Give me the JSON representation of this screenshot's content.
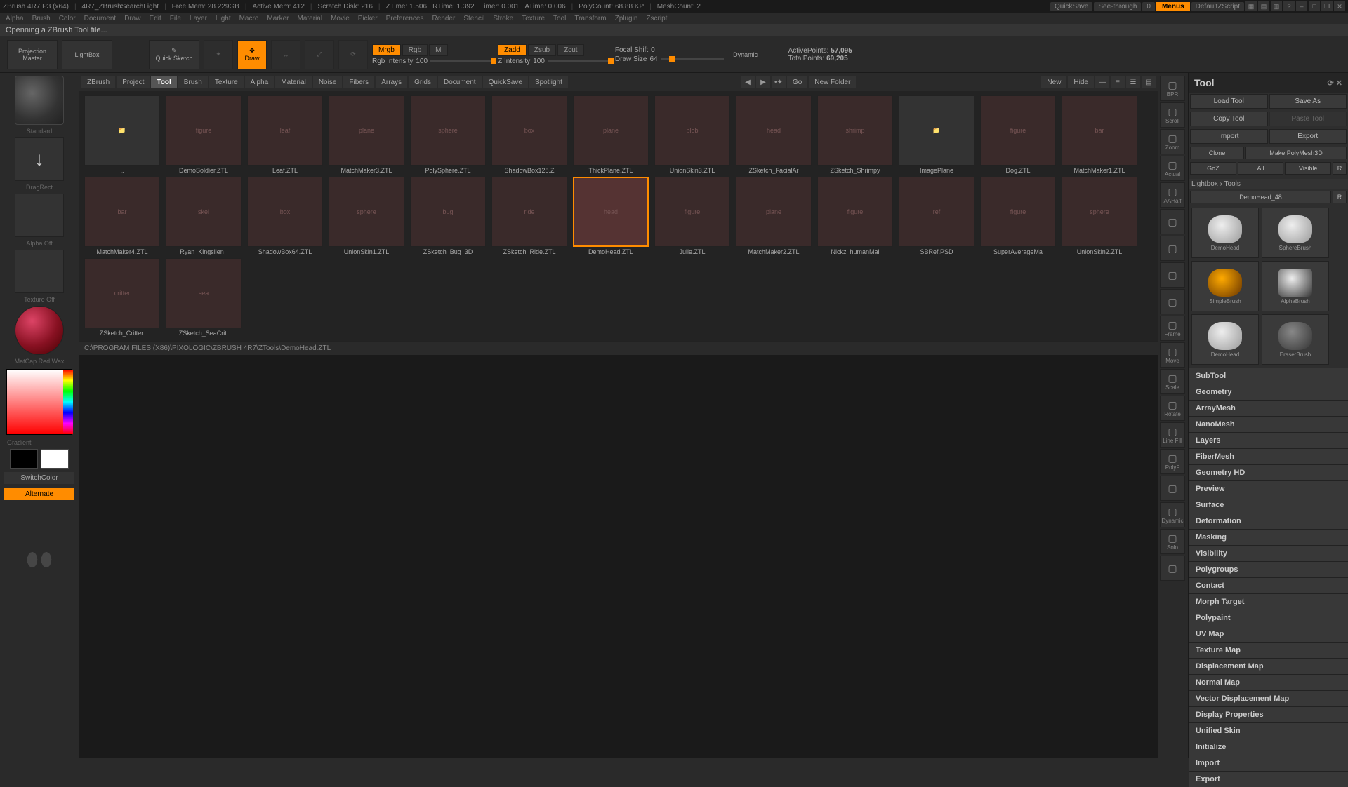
{
  "titlebar": {
    "app": "ZBrush 4R7 P3 (x64)",
    "doc": "4R7_ZBrushSearchLight",
    "mem": "Free Mem: 28.229GB",
    "activemem": "Active Mem: 412",
    "scratch": "Scratch Disk: 216",
    "ztime": "ZTime: 1.506",
    "rtime": "RTime: 1.392",
    "timer": "Timer: 0.001",
    "atime": "ATime: 0.006",
    "polycount": "PolyCount: 68.88 KP",
    "meshcount": "MeshCount: 2",
    "quicksave": "QuickSave",
    "seethrough": "See-through",
    "seethrough_val": "0",
    "menus": "Menus",
    "script": "DefaultZScript"
  },
  "menubar": [
    "Alpha",
    "Brush",
    "Color",
    "Document",
    "Draw",
    "Edit",
    "File",
    "Layer",
    "Light",
    "Macro",
    "Marker",
    "Material",
    "Movie",
    "Picker",
    "Preferences",
    "Render",
    "Stencil",
    "Stroke",
    "Texture",
    "Tool",
    "Transform",
    "Zplugin",
    "Zscript"
  ],
  "status": "Openning a ZBrush Tool file...",
  "toolbar": {
    "projection": "Projection Master",
    "lightbox": "LightBox",
    "quicksketch": "Quick Sketch",
    "draw": "Draw",
    "mrgb": "Mrgb",
    "rgb": "Rgb",
    "m": "M",
    "rgb_intensity": "Rgb Intensity",
    "rgb_intensity_val": "100",
    "zadd": "Zadd",
    "zsub": "Zsub",
    "zcut": "Zcut",
    "z_intensity": "Z Intensity",
    "z_intensity_val": "100",
    "focal": "Focal Shift",
    "focal_val": "0",
    "drawsize": "Draw Size",
    "drawsize_val": "64",
    "dynamic": "Dynamic",
    "activepoints": "ActivePoints:",
    "activepoints_val": "57,095",
    "totalpoints": "TotalPoints:",
    "totalpoints_val": "69,205"
  },
  "lightbox": {
    "tabs": [
      "ZBrush",
      "Project",
      "Tool",
      "Brush",
      "Texture",
      "Alpha",
      "Material",
      "Noise",
      "Fibers",
      "Arrays",
      "Grids",
      "Document",
      "QuickSave",
      "Spotlight"
    ],
    "active_tab": "Tool",
    "go": "Go",
    "newfolder": "New Folder",
    "new": "New",
    "hide": "Hide",
    "items": [
      {
        "label": "..",
        "type": "folder"
      },
      {
        "label": "DemoSoldier.ZTL",
        "hint": "figure"
      },
      {
        "label": "Leaf.ZTL",
        "hint": "leaf"
      },
      {
        "label": "MatchMaker3.ZTL",
        "hint": "plane"
      },
      {
        "label": "PolySphere.ZTL",
        "hint": "sphere"
      },
      {
        "label": "ShadowBox128.Z",
        "hint": "box"
      },
      {
        "label": "ThickPlane.ZTL",
        "hint": "plane"
      },
      {
        "label": "UnionSkin3.ZTL",
        "hint": "blob"
      },
      {
        "label": "ZSketch_FacialAr",
        "hint": "head"
      },
      {
        "label": "ZSketch_Shrimpy",
        "hint": "shrimp"
      },
      {
        "label": "ImagePlane",
        "type": "folder"
      },
      {
        "label": "Dog.ZTL",
        "hint": "figure"
      },
      {
        "label": "MatchMaker1.ZTL",
        "hint": "bar"
      },
      {
        "label": "MatchMaker4.ZTL",
        "hint": "bar"
      },
      {
        "label": "Ryan_Kingslien_",
        "hint": "skel"
      },
      {
        "label": "ShadowBox64.ZTL",
        "hint": "box"
      },
      {
        "label": "UnionSkin1.ZTL",
        "hint": "sphere"
      },
      {
        "label": "ZSketch_Bug_3D",
        "hint": "bug"
      },
      {
        "label": "ZSketch_Ride.ZTL",
        "hint": "ride"
      },
      {
        "label": "DemoHead.ZTL",
        "hint": "head",
        "selected": true
      },
      {
        "label": "Julie.ZTL",
        "hint": "figure"
      },
      {
        "label": "MatchMaker2.ZTL",
        "hint": "plane"
      },
      {
        "label": "Nickz_humanMal",
        "hint": "figure"
      },
      {
        "label": "SBRef.PSD",
        "hint": "ref"
      },
      {
        "label": "SuperAverageMa",
        "hint": "figure"
      },
      {
        "label": "UnionSkin2.ZTL",
        "hint": "sphere"
      },
      {
        "label": "ZSketch_Critter.",
        "hint": "critter"
      },
      {
        "label": "ZSketch_SeaCrit.",
        "hint": "sea"
      }
    ],
    "path": "C:\\PROGRAM FILES (X86)\\PIXOLOGIC\\ZBRUSH 4R7\\ZTools\\DemoHead.ZTL"
  },
  "leftbar": {
    "standard": "Standard",
    "dragrect": "DragRect",
    "alpha": "Alpha  Off",
    "texture": "Texture Off",
    "material": "MatCap Red Wax",
    "gradient": "Gradient",
    "switchcolor": "SwitchColor",
    "alternate": "Alternate"
  },
  "rightshelf": [
    "BPR",
    "Scroll",
    "Zoom",
    "Actual",
    "AAHalf",
    "",
    "",
    "",
    "",
    "Frame",
    "Move",
    "Scale",
    "Rotate",
    "Line Fill",
    "PolyF",
    "",
    "Dynamic",
    "Solo",
    ""
  ],
  "toolpanel": {
    "title": "Tool",
    "load": "Load Tool",
    "save": "Save As",
    "copy": "Copy Tool",
    "paste": "Paste Tool",
    "import": "Import",
    "export": "Export",
    "clone": "Clone",
    "makepoly": "Make PolyMesh3D",
    "goz": "GoZ",
    "all": "All",
    "visible": "Visible",
    "r": "R",
    "lbtools": "Lightbox › Tools",
    "current": "DemoHead_48",
    "thumbs": [
      "DemoHead",
      "SphereBrush",
      "SimpleBrush",
      "AlphaBrush",
      "DemoHead",
      "EraserBrush"
    ],
    "categories": [
      "SubTool",
      "Geometry",
      "ArrayMesh",
      "NanoMesh",
      "Layers",
      "FiberMesh",
      "Geometry HD",
      "Preview",
      "Surface",
      "Deformation",
      "Masking",
      "Visibility",
      "Polygroups",
      "Contact",
      "Morph Target",
      "Polypaint",
      "UV Map",
      "Texture Map",
      "Displacement Map",
      "Normal Map",
      "Vector Displacement Map",
      "Display Properties",
      "Unified Skin",
      "Initialize",
      "Import",
      "Export"
    ]
  }
}
